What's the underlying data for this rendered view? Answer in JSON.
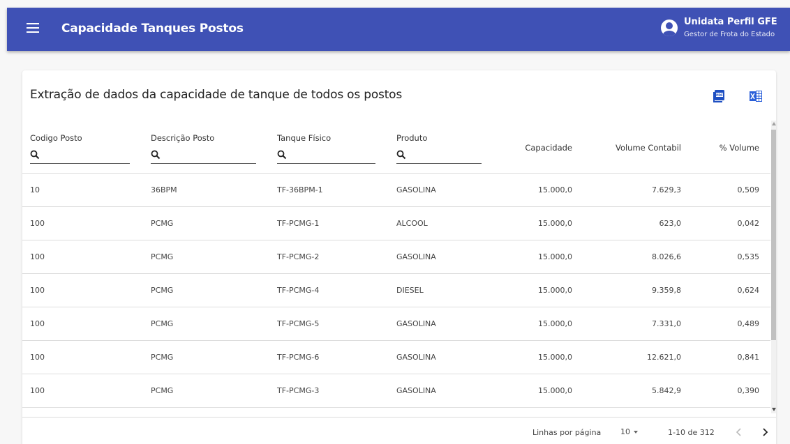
{
  "header": {
    "title": "Capacidade Tanques Postos",
    "user_name": "Unidata Perfil GFE",
    "user_role": "Gestor de Frota do Estado"
  },
  "card": {
    "title": "Extração de dados da capacidade de tanque de todos os postos",
    "export_pdf_icon": "pdf-icon",
    "export_excel_icon": "excel-icon"
  },
  "table": {
    "columns": {
      "codigo": "Codigo Posto",
      "descricao": "Descrição Posto",
      "tanque": "Tanque Físico",
      "produto": "Produto",
      "capacidade": "Capacidade",
      "volume": "Volume Contabil",
      "pct": "% Volume"
    },
    "rows": [
      [
        "10",
        "36BPM",
        "TF-36BPM-1",
        "GASOLINA",
        "15.000,0",
        "7.629,3",
        "0,509"
      ],
      [
        "100",
        "PCMG",
        "TF-PCMG-1",
        "ALCOOL",
        "15.000,0",
        "623,0",
        "0,042"
      ],
      [
        "100",
        "PCMG",
        "TF-PCMG-2",
        "GASOLINA",
        "15.000,0",
        "8.026,6",
        "0,535"
      ],
      [
        "100",
        "PCMG",
        "TF-PCMG-4",
        "DIESEL",
        "15.000,0",
        "9.359,8",
        "0,624"
      ],
      [
        "100",
        "PCMG",
        "TF-PCMG-5",
        "GASOLINA",
        "15.000,0",
        "7.331,0",
        "0,489"
      ],
      [
        "100",
        "PCMG",
        "TF-PCMG-6",
        "GASOLINA",
        "15.000,0",
        "12.621,0",
        "0,841"
      ],
      [
        "100",
        "PCMG",
        "TF-PCMG-3",
        "GASOLINA",
        "15.000,0",
        "5.842,9",
        "0,390"
      ]
    ]
  },
  "pagination": {
    "rows_label": "Linhas por página",
    "rows_value": "10",
    "range": "1-10 de 312"
  },
  "colors": {
    "header_bg": "#3f51b5",
    "pdf_icon": "#1e4fc2",
    "excel_icon": "#2a5fd9"
  }
}
